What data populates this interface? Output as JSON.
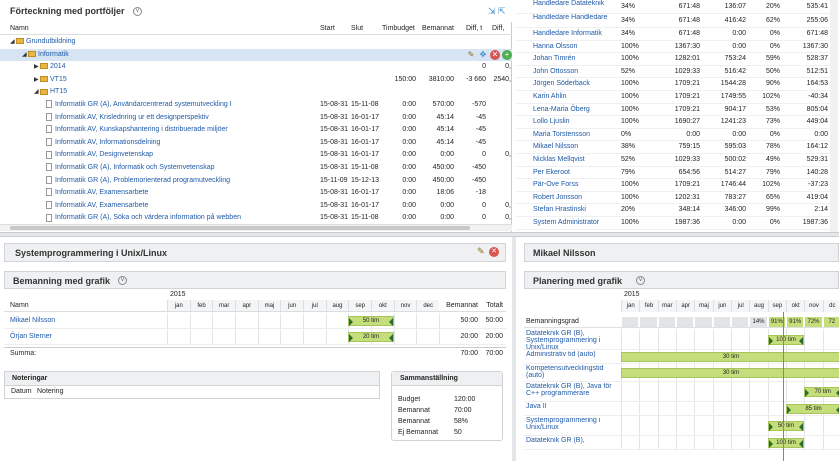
{
  "portfolio": {
    "title": "Förteckning med portföljer",
    "columns": [
      "Namn",
      "Start",
      "Slut",
      "Timbudget",
      "Bemannat",
      "Diff, t",
      "Diff, "
    ],
    "tree": [
      {
        "label": "Grundutbildning",
        "kind": "folder",
        "indent": 0,
        "open": true
      },
      {
        "label": "Informatik",
        "kind": "folder",
        "indent": 1,
        "open": true,
        "selected": true
      },
      {
        "label": "2014",
        "kind": "folder",
        "indent": 2,
        "open": false,
        "diff": "0",
        "diffp": "0,"
      },
      {
        "label": "VT15",
        "kind": "folder",
        "indent": 2,
        "open": false,
        "budget": "150:00",
        "bem": "3810:00",
        "diff": "-3 660",
        "diffp": "2540,"
      },
      {
        "label": "HT15",
        "kind": "folder",
        "indent": 2,
        "open": true
      },
      {
        "label": "Informatik GR (A), Användarcentrerad systemutveckling I",
        "kind": "doc",
        "indent": 3,
        "start": "15-08-31",
        "end": "15-11-08",
        "budget": "0:00",
        "bem": "570:00",
        "diff": "-570",
        "diffp": ""
      },
      {
        "label": "Informatik AV, Krislednring ur ett designperspektiv",
        "kind": "doc",
        "indent": 3,
        "start": "15-08-31",
        "end": "16-01-17",
        "budget": "0:00",
        "bem": "45:14",
        "diff": "-45",
        "diffp": ""
      },
      {
        "label": "Informatik AV, Kunskapshantering i distribuerade miljöer",
        "kind": "doc",
        "indent": 3,
        "start": "15-08-31",
        "end": "16-01-17",
        "budget": "0:00",
        "bem": "45:14",
        "diff": "-45",
        "diffp": ""
      },
      {
        "label": "Informatik AV, Informationsdelning",
        "kind": "doc",
        "indent": 3,
        "start": "15-08-31",
        "end": "16-01-17",
        "budget": "0:00",
        "bem": "45:14",
        "diff": "-45",
        "diffp": ""
      },
      {
        "label": "Informatik AV, Designvetenskap",
        "kind": "doc",
        "indent": 3,
        "start": "15-08-31",
        "end": "16-01-17",
        "budget": "0:00",
        "bem": "0:00",
        "diff": "0",
        "diffp": "0,"
      },
      {
        "label": "Informatik GR (A), Informatik och Systemvetenskap",
        "kind": "doc",
        "indent": 3,
        "start": "15-08-31",
        "end": "15-11-08",
        "budget": "0:00",
        "bem": "450:00",
        "diff": "-450",
        "diffp": ""
      },
      {
        "label": "Informatik GR (A), Problemorienterad programutveckling",
        "kind": "doc",
        "indent": 3,
        "start": "15-11-09",
        "end": "15-12-13",
        "budget": "0:00",
        "bem": "450:00",
        "diff": "-450",
        "diffp": ""
      },
      {
        "label": "Informatik AV, Examensarbete",
        "kind": "doc",
        "indent": 3,
        "start": "15-08-31",
        "end": "16-01-17",
        "budget": "0:00",
        "bem": "18:06",
        "diff": "-18",
        "diffp": ""
      },
      {
        "label": "Informatik AV, Examensarbete",
        "kind": "doc",
        "indent": 3,
        "start": "15-08-31",
        "end": "16-01-17",
        "budget": "0:00",
        "bem": "0:00",
        "diff": "0",
        "diffp": "0,"
      },
      {
        "label": "Informatik GR (A), Söka och värdera information på webben",
        "kind": "doc",
        "indent": 3,
        "start": "15-08-31",
        "end": "15-11-08",
        "budget": "0:00",
        "bem": "0:00",
        "diff": "0",
        "diffp": "0,"
      }
    ]
  },
  "staff": {
    "rows": [
      {
        "name": "Handledare Datateknik",
        "pct": "34%",
        "a": "671:48",
        "b": "136:07",
        "c": "20%",
        "d": "535:41"
      },
      {
        "name": "Handledare Handledare",
        "pct": "34%",
        "a": "671:48",
        "b": "416:42",
        "c": "62%",
        "d": "255:06"
      },
      {
        "name": "Handledare Informatik",
        "pct": "34%",
        "a": "671:48",
        "b": "0:00",
        "c": "0%",
        "d": "671:48"
      },
      {
        "name": "Hanna Olsson",
        "pct": "100%",
        "a": "1367:30",
        "b": "0:00",
        "c": "0%",
        "d": "1367:30"
      },
      {
        "name": "Johan Timrén",
        "pct": "100%",
        "a": "1282:01",
        "b": "753:24",
        "c": "59%",
        "d": "528:37"
      },
      {
        "name": "John Ottosson",
        "pct": "52%",
        "a": "1029:33",
        "b": "516:42",
        "c": "50%",
        "d": "512:51"
      },
      {
        "name": "Jörgen Söderback",
        "pct": "100%",
        "a": "1709:21",
        "b": "1544:28",
        "c": "90%",
        "d": "164:53"
      },
      {
        "name": "Karin Ahlin",
        "pct": "100%",
        "a": "1709:21",
        "b": "1749:55",
        "c": "102%",
        "d": "-40:34"
      },
      {
        "name": "Lena-Maria Öberg",
        "pct": "100%",
        "a": "1709:21",
        "b": "904:17",
        "c": "53%",
        "d": "805:04"
      },
      {
        "name": "Lollo Ljuslin",
        "pct": "100%",
        "a": "1690:27",
        "b": "1241:23",
        "c": "73%",
        "d": "449:04"
      },
      {
        "name": "Maria Torstensson",
        "pct": "0%",
        "a": "0:00",
        "b": "0:00",
        "c": "0%",
        "d": "0:00"
      },
      {
        "name": "Mikael Nilsson",
        "pct": "38%",
        "a": "759:15",
        "b": "595:03",
        "c": "78%",
        "d": "164:12"
      },
      {
        "name": "Nicklas Mellqvist",
        "pct": "52%",
        "a": "1029:33",
        "b": "500:02",
        "c": "49%",
        "d": "529:31"
      },
      {
        "name": "Per Ekeroot",
        "pct": "79%",
        "a": "654:56",
        "b": "514:27",
        "c": "79%",
        "d": "140:28"
      },
      {
        "name": "Pär-Ove Forss",
        "pct": "100%",
        "a": "1709:21",
        "b": "1746:44",
        "c": "102%",
        "d": "-37:23"
      },
      {
        "name": "Robert Jonsson",
        "pct": "100%",
        "a": "1202:31",
        "b": "783:27",
        "c": "65%",
        "d": "419:04"
      },
      {
        "name": "Stefan Hrastinski",
        "pct": "20%",
        "a": "348:14",
        "b": "346:00",
        "c": "99%",
        "d": "2:14"
      },
      {
        "name": "System Administrator",
        "pct": "100%",
        "a": "1987:36",
        "b": "0:00",
        "c": "0%",
        "d": "1987:36"
      }
    ]
  },
  "course": {
    "title": "Systemprogrammering i Unix/Linux",
    "staffing_title": "Bemanning med grafik",
    "year": "2015",
    "months": [
      "jan",
      "feb",
      "mar",
      "apr",
      "maj",
      "jun",
      "jul",
      "aug",
      "sep",
      "okt",
      "nov",
      "dec"
    ],
    "col_name": "Namn",
    "col_bem": "Bemannat",
    "col_tot": "Totalt",
    "rows": [
      {
        "name": "Mikael Nilsson",
        "bar": "50 tim",
        "bem": "50:00",
        "tot": "50:00"
      },
      {
        "name": "Örjan Sterner",
        "bar": "20 tim",
        "bem": "20:00",
        "tot": "20:00"
      }
    ],
    "sum_label": "Summa:",
    "sum_bem": "70:00",
    "sum_tot": "70:00",
    "notes_title": "Noteringar",
    "notes_cols": [
      "Datum",
      "Notering"
    ],
    "summary_title": "Sammanställning",
    "summary": [
      {
        "label": "Budget",
        "value": "120:00"
      },
      {
        "label": "Bemannat",
        "value": "70:00"
      },
      {
        "label": "Bemannat",
        "value": "58%"
      },
      {
        "label": "Ej Bemannat",
        "value": "50"
      }
    ]
  },
  "person": {
    "title": "Mikael Nilsson",
    "planning_title": "Planering med grafik",
    "year": "2015",
    "months": [
      "jan",
      "feb",
      "mar",
      "apr",
      "maj",
      "jun",
      "jul",
      "aug",
      "sep",
      "okt",
      "nov",
      "dc"
    ],
    "degree_label": "Bemanningsgrad",
    "degree_values": [
      "14%",
      "91%",
      "91%",
      "72%",
      "72"
    ],
    "rows": [
      {
        "name": "Datateknik GR (B), Systemprogrammering i Unix/Linux",
        "bar": "100 tim"
      },
      {
        "name": "Administrativ tid (auto)",
        "bar": "30 tim"
      },
      {
        "name": "Kompetensutvecklingstid (auto)",
        "bar": "30 tim"
      },
      {
        "name": "Datateknik GR (B), Java för C++ programmerare",
        "bar": "70 tim"
      },
      {
        "name": "Java II",
        "bar": "85 tim"
      },
      {
        "name": "Systemprogrammering i Unix/Linux",
        "bar": "50 tim"
      },
      {
        "name": "Datateknik GR (B), ",
        "bar": "100 tim"
      }
    ]
  },
  "colors": {
    "link": "#1f5aa8",
    "bar": "#c5de7c",
    "today": "#e06060",
    "header": "#eef0f2"
  }
}
